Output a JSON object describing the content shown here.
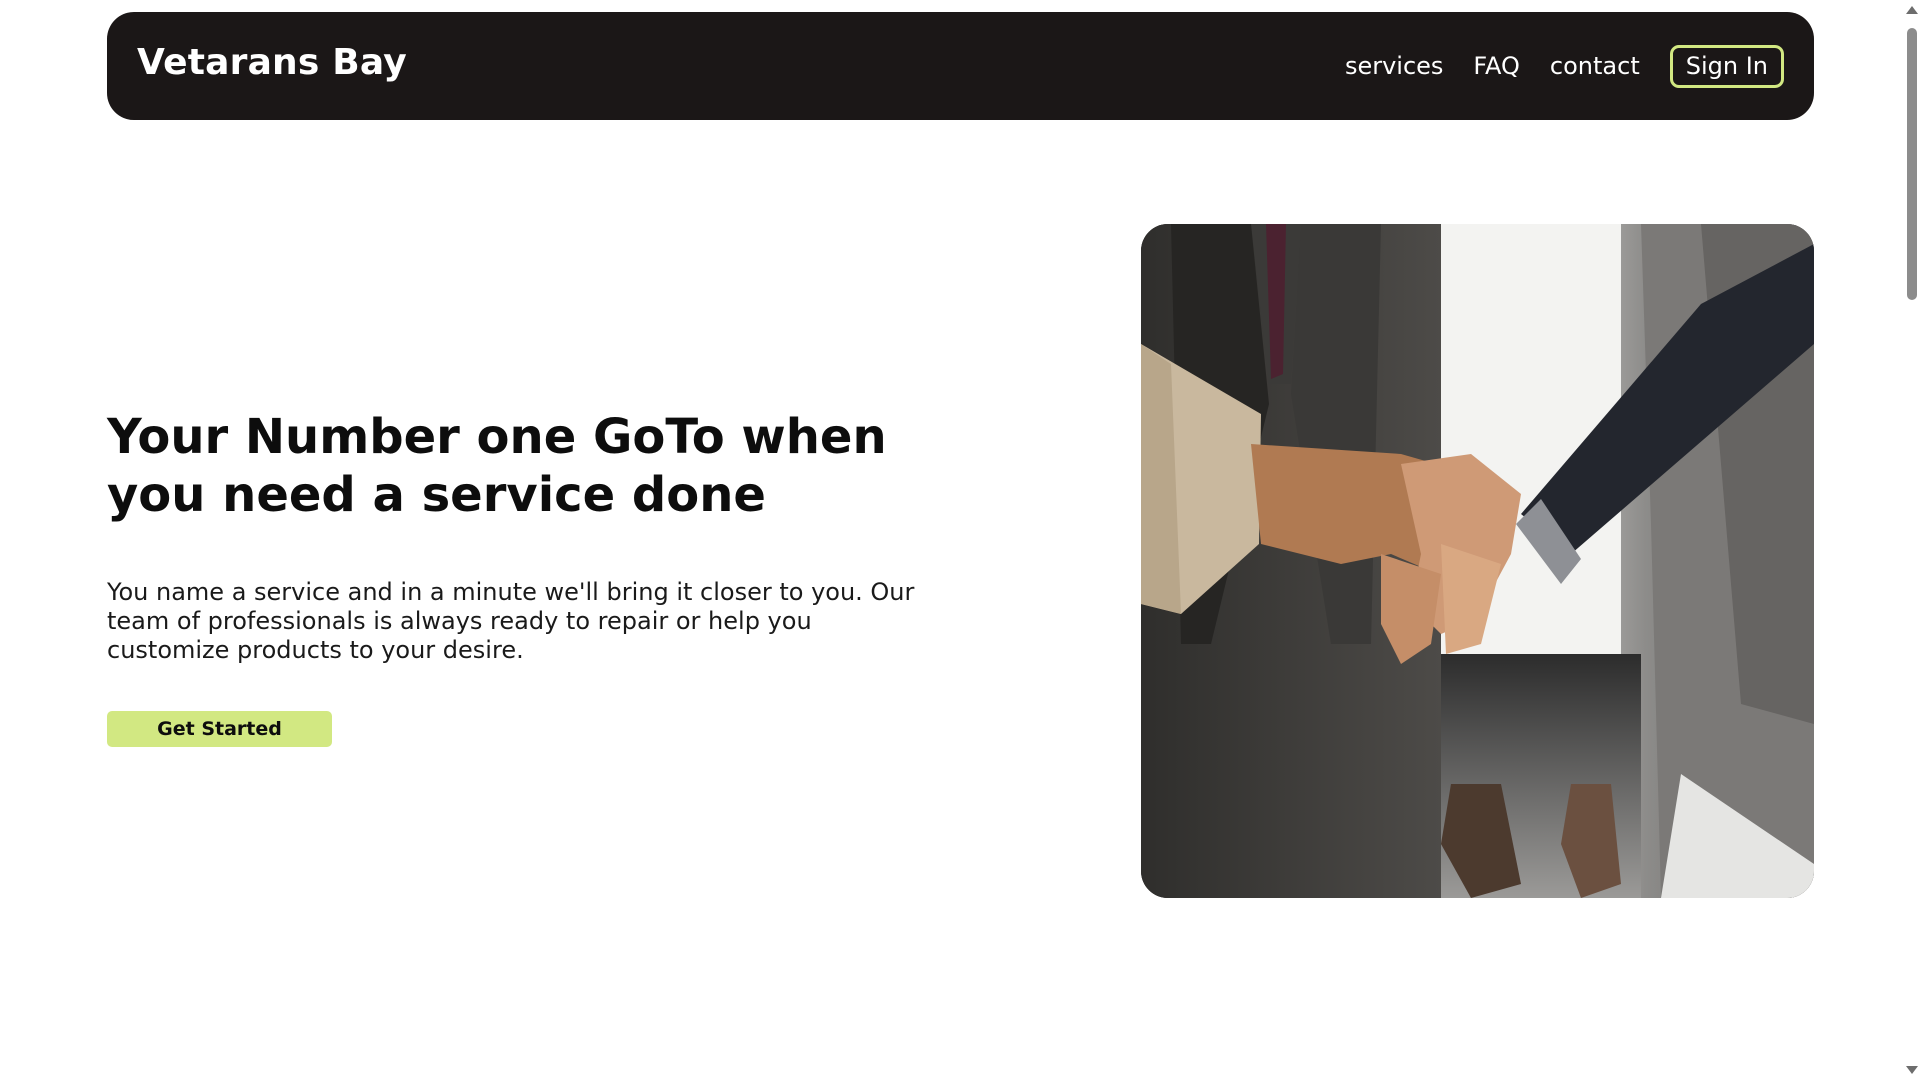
{
  "navbar": {
    "brand": "Vetarans Bay",
    "links": [
      "services",
      "FAQ",
      "contact"
    ],
    "signin_label": "Sign In"
  },
  "hero": {
    "title": "Your Number one GoTo when you need a service done",
    "description": "You name a service and in a minute we'll bring it closer to you. Our team of professionals is always ready to repair or help you customize products to your desire.",
    "cta_label": "Get Started",
    "image_icon": "handshake-photo"
  },
  "colors": {
    "navbar_bg": "#1b1717",
    "accent": "#d2e882",
    "text": "#0d0d0d"
  }
}
